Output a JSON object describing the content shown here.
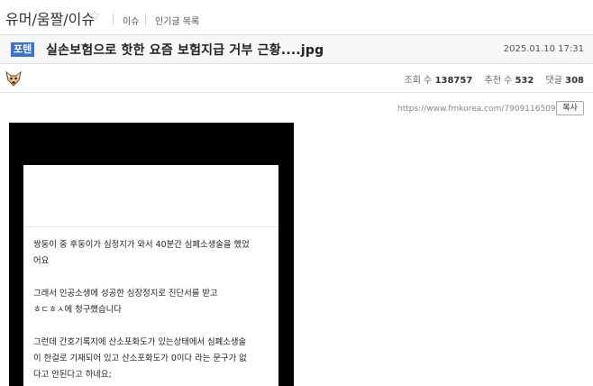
{
  "header": {
    "board_title": "유머/움짤/이슈",
    "links": [
      "이슈",
      "인기글 목록"
    ]
  },
  "post": {
    "tag": "포텐",
    "title": "실손보험으로 핫한 요즘 보험지급 거부 근황....jpg",
    "date": "2025.01.10 17:31",
    "stats": {
      "views_label": "조회 수",
      "views": "138757",
      "recommend_label": "추천 수",
      "recommend": "532",
      "comments_label": "댓글",
      "comments": "308"
    },
    "url": "https://www.fmkorea.com/7909116509",
    "copy_label": "복사"
  },
  "image_text": {
    "p1": [
      "쌍둥이 중 후둥이가 심정지가 와서 40분간 심폐소생술을 했었",
      "어요"
    ],
    "p2": [
      "그래서 인공소생에 성공한 심장정지로 진단서를 받고",
      "ㅎㄷㅎㅅ에 청구했습니다"
    ],
    "p3": [
      "그런데 간호기록지에 산소포화도가 있는상태에서 심폐소생술",
      "이 한걸로 기재되어 있고 산소포화도가 0이다 라는 문구가 없",
      "다고 안된다고 하네요;"
    ]
  },
  "colors": {
    "tag_bg": "#3b6fd0",
    "image_bg": "#000000"
  },
  "icons": {
    "star": "star-outline-icon",
    "avatar": "dog-avatar-icon"
  }
}
